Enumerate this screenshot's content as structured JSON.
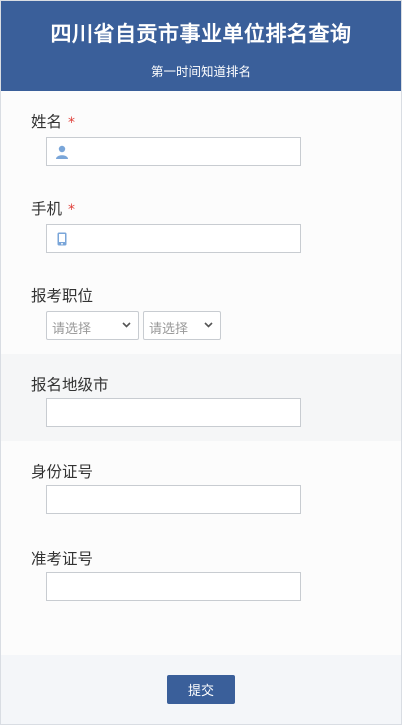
{
  "header": {
    "title": "四川省自贡市事业单位排名查询",
    "subtitle": "第一时间知道排名"
  },
  "fields": {
    "name": {
      "label": "姓名",
      "required_mark": "*",
      "value": "",
      "icon": "person-icon"
    },
    "phone": {
      "label": "手机",
      "required_mark": "*",
      "value": "",
      "icon": "mobile-phone-icon"
    },
    "position": {
      "label": "报考职位",
      "select1": "请选择",
      "select2": "请选择"
    },
    "city": {
      "label": "报名地级市",
      "value": ""
    },
    "id_number": {
      "label": "身份证号",
      "value": ""
    },
    "exam_number": {
      "label": "准考证号",
      "value": ""
    }
  },
  "footer": {
    "submit_label": "提交"
  },
  "colors": {
    "primary": "#3a5f9a",
    "required": "#e0413b",
    "icon": "#7aa6d9"
  }
}
